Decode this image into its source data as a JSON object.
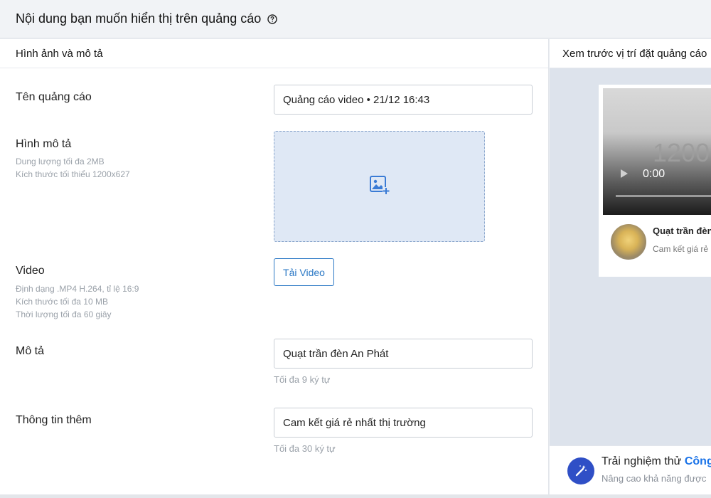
{
  "header": {
    "title": "Nội dung bạn muốn hiển thị trên quảng cáo",
    "help_icon": "question-circle-icon"
  },
  "left": {
    "section_title": "Hình ảnh và mô tả",
    "ad_name": {
      "label": "Tên quảng cáo",
      "value": "Quảng cáo video • 21/12 16:43"
    },
    "image": {
      "label": "Hình mô tả",
      "hints": [
        "Dung lượng tối đa 2MB",
        "Kích thước tối thiểu 1200x627"
      ],
      "upload_icon": "add-image-icon"
    },
    "video": {
      "label": "Video",
      "hints": [
        "Định dạng .MP4 H.264, tỉ lệ 16:9",
        "Kích thước tối đa 10 MB",
        "Thời lượng tối đa 60 giây"
      ],
      "button_label": "Tải Video"
    },
    "description": {
      "label": "Mô tả",
      "value": "Quạt trần đèn An Phát",
      "limit_hint": "Tối đa 9 ký tự"
    },
    "extra_info": {
      "label": "Thông tin thêm",
      "value": "Cam kết giá rẻ nhất thị trường",
      "limit_hint": "Tối đa 30 ký tự"
    }
  },
  "right": {
    "preview_title": "Xem trước vị trí đặt quảng cáo",
    "ad_preview": {
      "video_placeholder": "1200",
      "time": "0:00",
      "title": "Quạt trần đèn",
      "description": "Cam kết giá rẻ"
    },
    "promo": {
      "title_prefix": "Trải nghiệm thử",
      "title_link": "Công",
      "subtitle": "Nâng cao khả năng được",
      "icon": "magic-wand-icon"
    }
  }
}
